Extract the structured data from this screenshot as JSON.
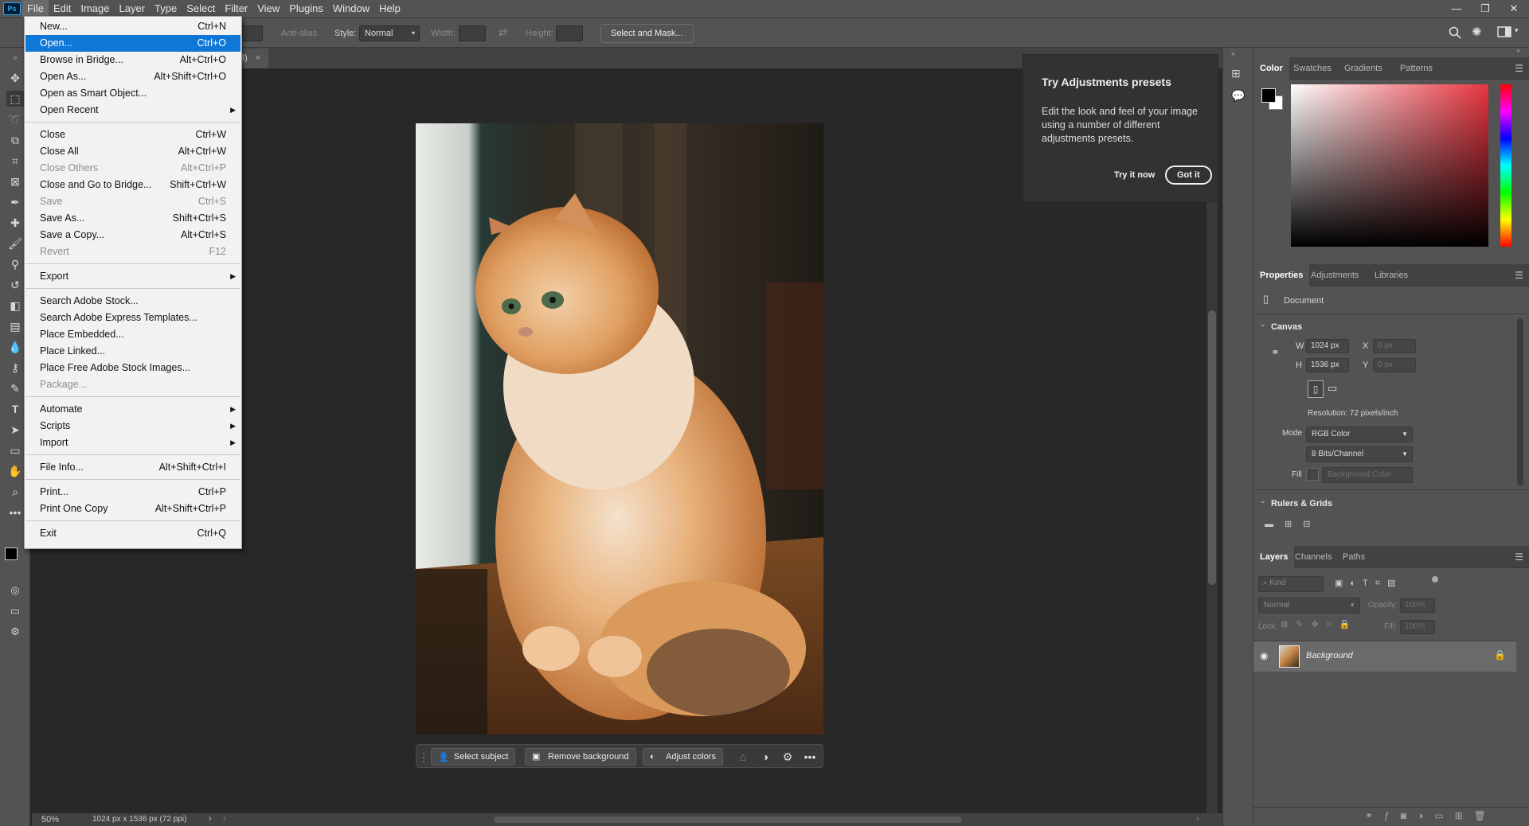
{
  "app": {
    "logo": "Ps"
  },
  "menubar": {
    "items": [
      "File",
      "Edit",
      "Image",
      "Layer",
      "Type",
      "Select",
      "Filter",
      "View",
      "Plugins",
      "Window",
      "Help"
    ]
  },
  "window_controls": {
    "minimize": "—",
    "restore": "❐",
    "close": "✕"
  },
  "options": {
    "antialias": "Anti-alias",
    "style_label": "Style:",
    "style_value": "Normal",
    "width_label": "Width:",
    "height_label": "Height:",
    "select_mask": "Select and Mask..."
  },
  "document": {
    "tab_title": "/8)",
    "zoom": "50%",
    "info": "1024 px x 1536 px (72 ppi)"
  },
  "file_menu": [
    {
      "label": "New...",
      "shortcut": "Ctrl+N"
    },
    {
      "label": "Open...",
      "shortcut": "Ctrl+O",
      "highlight": true
    },
    {
      "label": "Browse in Bridge...",
      "shortcut": "Alt+Ctrl+O"
    },
    {
      "label": "Open As...",
      "shortcut": "Alt+Shift+Ctrl+O"
    },
    {
      "label": "Open as Smart Object...",
      "shortcut": ""
    },
    {
      "label": "Open Recent",
      "shortcut": "",
      "submenu": true
    },
    {
      "label": "Close",
      "shortcut": "Ctrl+W"
    },
    {
      "label": "Close All",
      "shortcut": "Alt+Ctrl+W"
    },
    {
      "label": "Close Others",
      "shortcut": "Alt+Ctrl+P",
      "disabled": true
    },
    {
      "label": "Close and Go to Bridge...",
      "shortcut": "Shift+Ctrl+W"
    },
    {
      "label": "Save",
      "shortcut": "Ctrl+S",
      "disabled": true
    },
    {
      "label": "Save As...",
      "shortcut": "Shift+Ctrl+S"
    },
    {
      "label": "Save a Copy...",
      "shortcut": "Alt+Ctrl+S"
    },
    {
      "label": "Revert",
      "shortcut": "F12",
      "disabled": true
    },
    {
      "label": "Export",
      "shortcut": "",
      "submenu": true
    },
    {
      "label": "Search Adobe Stock...",
      "shortcut": ""
    },
    {
      "label": "Search Adobe Express Templates...",
      "shortcut": ""
    },
    {
      "label": "Place Embedded...",
      "shortcut": ""
    },
    {
      "label": "Place Linked...",
      "shortcut": ""
    },
    {
      "label": "Place Free Adobe Stock Images...",
      "shortcut": ""
    },
    {
      "label": "Package...",
      "shortcut": "",
      "disabled": true
    },
    {
      "label": "Automate",
      "shortcut": "",
      "submenu": true
    },
    {
      "label": "Scripts",
      "shortcut": "",
      "submenu": true
    },
    {
      "label": "Import",
      "shortcut": "",
      "submenu": true
    },
    {
      "label": "File Info...",
      "shortcut": "Alt+Shift+Ctrl+I"
    },
    {
      "label": "Print...",
      "shortcut": "Ctrl+P"
    },
    {
      "label": "Print One Copy",
      "shortcut": "Alt+Shift+Ctrl+P"
    },
    {
      "label": "Exit",
      "shortcut": "Ctrl+Q"
    }
  ],
  "tip": {
    "title": "Try Adjustments presets",
    "body": "Edit the look and feel of your image using a number of different adjustments presets.",
    "try_now": "Try it now",
    "got_it": "Got it"
  },
  "contextual_bar": {
    "select_subject": "Select subject",
    "remove_background": "Remove background",
    "adjust_colors": "Adjust colors"
  },
  "color_panel": {
    "tabs": [
      "Color",
      "Swatches",
      "Gradients",
      "Patterns"
    ],
    "fg": "#000000",
    "bg": "#ffffff",
    "hue": "#e8353f"
  },
  "properties_panel": {
    "tabs": [
      "Properties",
      "Adjustments",
      "Libraries"
    ],
    "doc_label": "Document",
    "canvas_section": "Canvas",
    "w_label": "W",
    "w_value": "1024 px",
    "h_label": "H",
    "h_value": "1536 px",
    "x_label": "X",
    "x_value": "0 px",
    "y_label": "Y",
    "y_value": "0 px",
    "resolution": "Resolution: 72 pixels/inch",
    "mode_label": "Mode",
    "mode_value": "RGB Color",
    "depth_value": "8 Bits/Channel",
    "fill_label": "Fill",
    "fill_value": "Background Color",
    "rulers_section": "Rulers & Grids"
  },
  "layers_panel": {
    "tabs": [
      "Layers",
      "Channels",
      "Paths"
    ],
    "kind_placeholder": "Kind",
    "blend_mode": "Normal",
    "opacity_label": "Opacity:",
    "opacity_value": "100%",
    "lock_label": "Lock:",
    "fill_label": "Fill:",
    "fill_value": "100%",
    "layers": [
      {
        "name": "Background"
      }
    ]
  }
}
